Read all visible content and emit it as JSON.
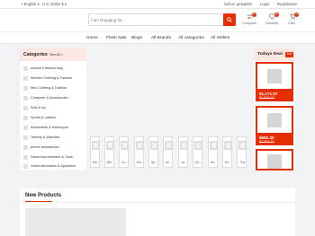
{
  "topbar": {
    "language": "English",
    "currency": "U.S. Dollar $",
    "seller_link": "Sell at: getsq001",
    "login": "Login",
    "registration": "Registration"
  },
  "search": {
    "placeholder": "I am shopping for..."
  },
  "header_icons": {
    "compare": {
      "label": "Compare",
      "count": "0"
    },
    "wishlist": {
      "label": "Wishlist",
      "count": "0"
    },
    "cart": {
      "label": "Cart",
      "count": "0"
    }
  },
  "nav": [
    "Home",
    "Flash Sale",
    "Blogs",
    "All Brands",
    "All categories",
    "All Sellers"
  ],
  "categories": {
    "title": "Categories",
    "see_all": "See All >",
    "items": [
      "women's fashion bag",
      "Women Clothing & Fashion",
      "Men Clothing & Fashion",
      "Computer & Accessories",
      "Kids & toy",
      "Sports & outdoor",
      "Automobile & Motorcycle",
      "Jewelry & Watches",
      "phone accessories",
      "Home Improvement & Tools",
      "Home decoration & Appliance"
    ]
  },
  "thumbs": [
    "We...",
    "We...",
    "Co...",
    "Kid...",
    "Sp...",
    "Au...",
    "Je...",
    "ph...",
    "Ho...",
    "Ho...",
    "Toy"
  ],
  "deal": {
    "title": "Todays Deal",
    "badge": "Hot",
    "items": [
      {
        "price": "$1,171.57",
        "old_price": "$1,505.27"
      },
      {
        "price": "$682.35",
        "old_price": "$2,581.37"
      }
    ]
  },
  "new_products": {
    "title": "New Products"
  }
}
